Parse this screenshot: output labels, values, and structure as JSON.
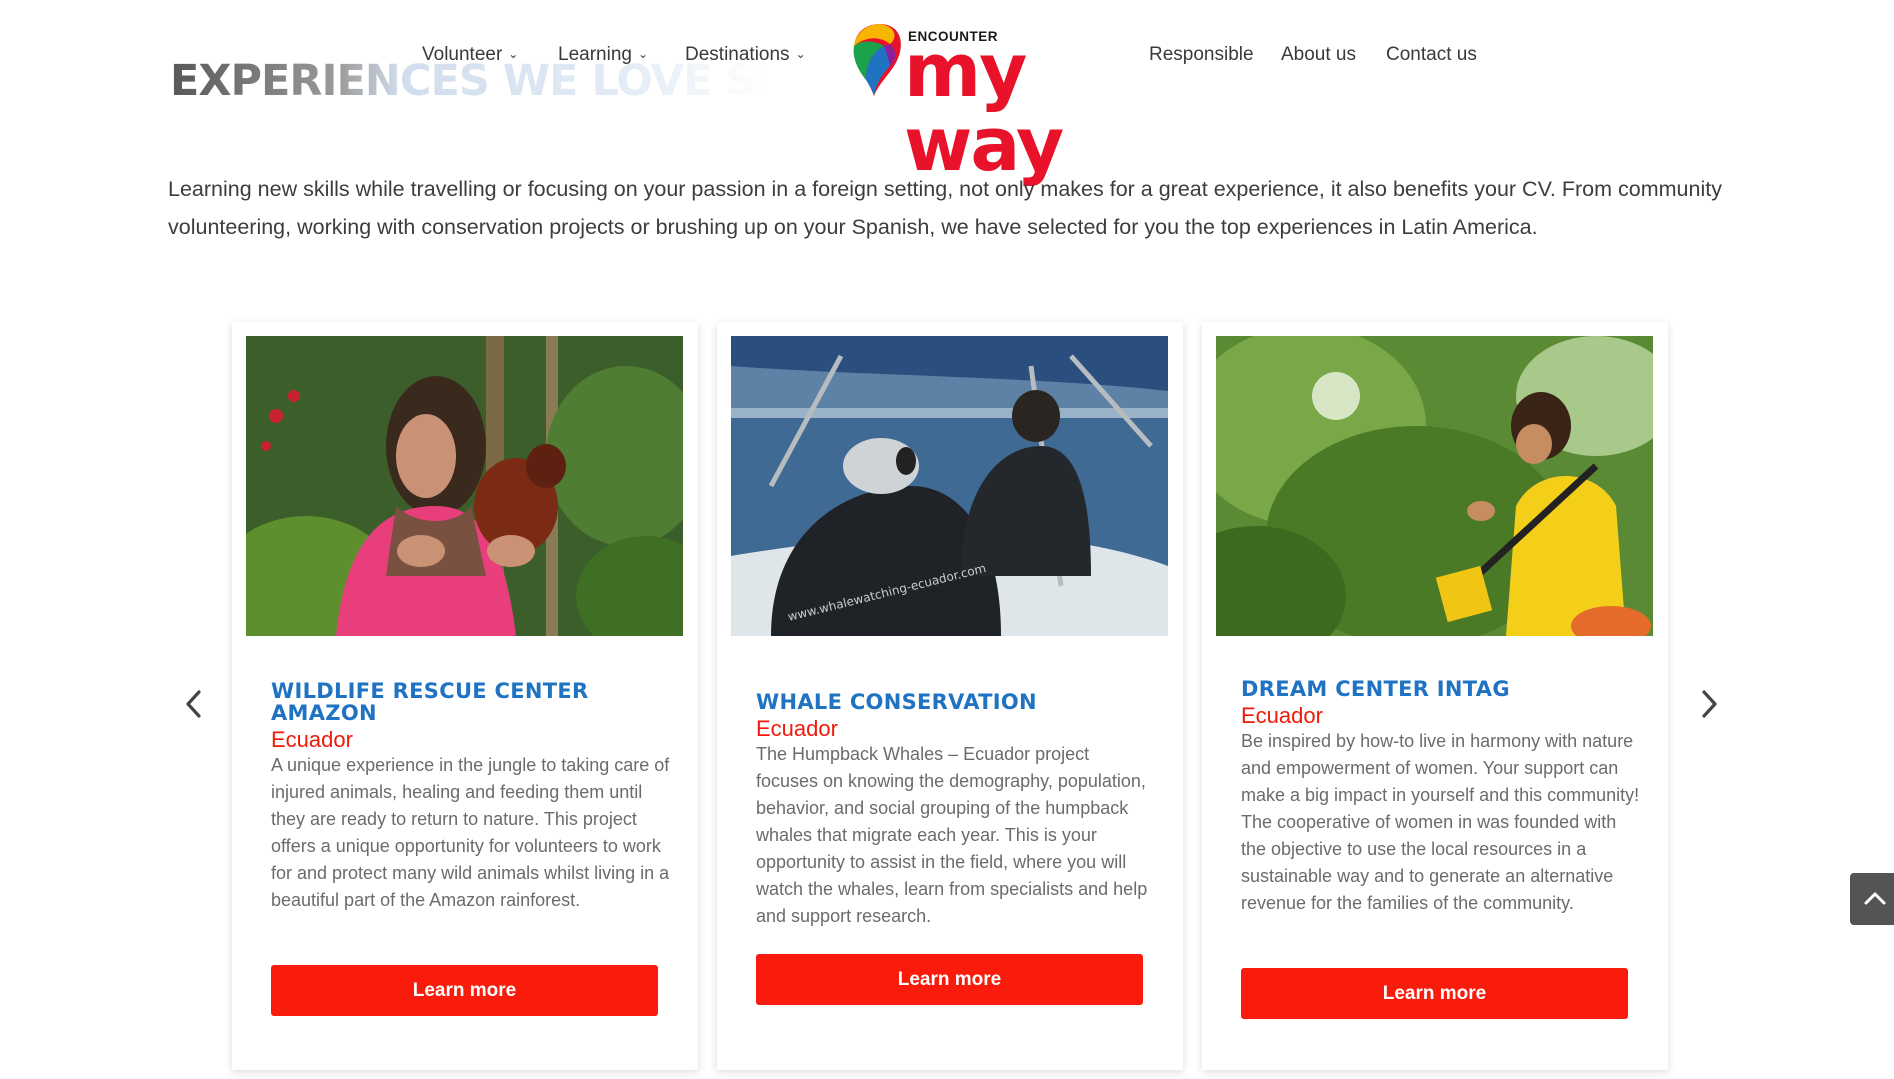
{
  "header": {
    "watermark": "EXPERIENCES WE LOVE SHARING",
    "nav_left": [
      {
        "label": "Volunteer"
      },
      {
        "label": "Learning"
      },
      {
        "label": "Destinations"
      }
    ],
    "nav_right": [
      {
        "label": "Responsible"
      },
      {
        "label": "About us"
      },
      {
        "label": "Contact us"
      }
    ],
    "logo": {
      "top_text": "ENCOUNTER",
      "main_text": "my way"
    }
  },
  "intro": {
    "text": "Learning new skills while travelling or focusing on your passion in a foreign setting, not only makes for a great experience, it also benefits your CV. From community volunteering, working with conservation projects or brushing up on your Spanish, we have selected for you the top experiences in Latin America."
  },
  "cards": [
    {
      "title": "WILDLIFE RESCUE CENTER AMAZON",
      "country": "Ecuador",
      "description": "A unique experience in the jungle to taking care of injured animals, healing and feeding them until they are ready to return to nature. This project offers a unique opportunity for volunteers to work for and protect many wild animals whilst living in a beautiful part of the Amazon rainforest.",
      "button": "Learn more"
    },
    {
      "title": "WHALE CONSERVATION",
      "country": "Ecuador",
      "description": "The Humpback Whales – Ecuador project focuses on knowing the demography, population, behavior, and social grouping of the humpback whales that migrate each year. This is your opportunity to assist in the field, where you will watch the whales, learn from specialists and help and support research.",
      "button": "Learn more",
      "photo_caption": "www.whalewatching-ecuador.com"
    },
    {
      "title": "DREAM CENTER INTAG",
      "country": "Ecuador",
      "description": "Be inspired by how-to live in harmony with nature and empowerment of women. Your support can make a big impact in yourself and this community! The cooperative of women in was founded with the objective to use the local resources in a sustainable way and to generate an alternative revenue for the families of the community.",
      "button": "Learn more"
    }
  ],
  "icons": {
    "prev": "chevron-left-icon",
    "next": "chevron-right-icon",
    "scroll_top": "chevron-up-icon",
    "dropdown": "chevron-down-icon"
  },
  "colors": {
    "accent": "#f91b0b",
    "title_blue": "#1f73c2",
    "country_red": "#f01a0a",
    "logo_red": "#e8132a"
  }
}
